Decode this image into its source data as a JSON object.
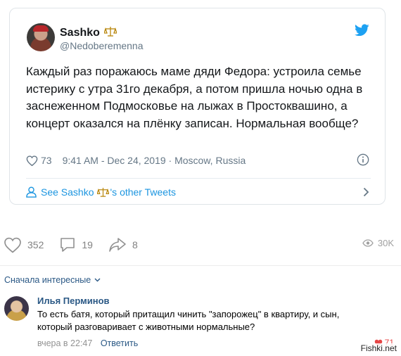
{
  "tweet": {
    "display_name": "Sashko",
    "handle": "@Nedoberemenna",
    "text": "Каждый раз поражаюсь маме дяди Федора: устроила семье истерику с утра 31го декабря, а потом пришла ночью одна в заснеженном Подмосковье на лыжах в Простоквашино, а концерт оказался на плёнку записан. Нормальная вообще?",
    "likes": "73",
    "timestamp": "9:41 AM - Dec 24, 2019 · Moscow, Russia",
    "other_tweets_prefix": "See Sashko",
    "other_tweets_suffix": "'s other Tweets",
    "brand_color": "#1da1f2",
    "link_color": "#1b95e0"
  },
  "actions": {
    "likes": "352",
    "comments": "19",
    "shares": "8",
    "views": "30K"
  },
  "comments_section": {
    "sort_label": "Сначала интересные",
    "comment": {
      "author": "Илья Перминов",
      "text": "То есть батя, который притащил чинить \"запорожец\" в квартиру, и сын, который разговаривает с животными нормальные?",
      "time": "вчера в 22:47",
      "reply_label": "Ответить",
      "likes": "71"
    }
  },
  "watermark": "Fishki.net"
}
